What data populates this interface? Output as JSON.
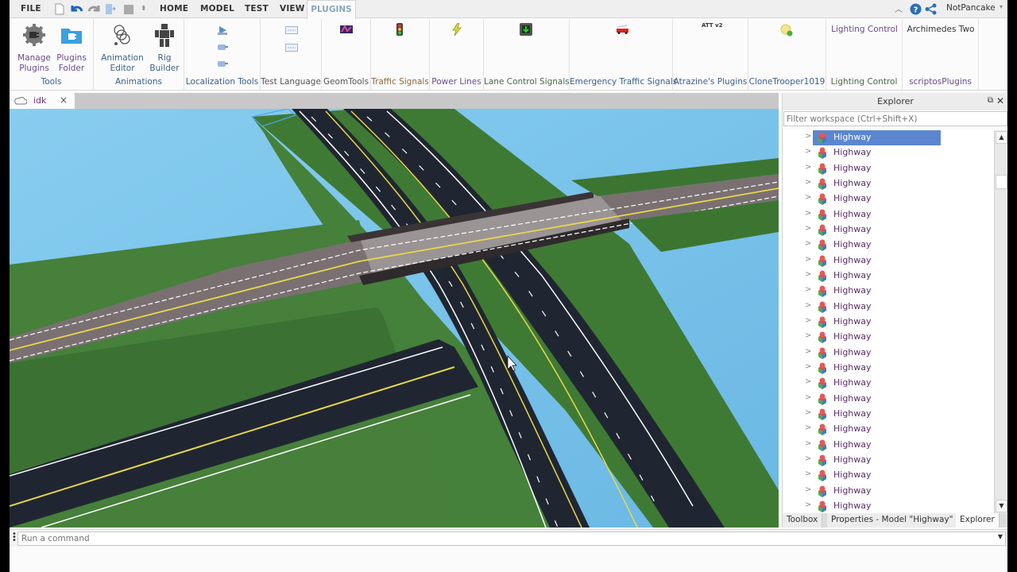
{
  "menubar": {
    "file": "FILE",
    "tabs": [
      "HOME",
      "MODEL",
      "TEST",
      "VIEW",
      "PLUGINS"
    ],
    "active_tab": "PLUGINS",
    "user": "NotPancake",
    "quick_access": [
      "new-file-icon",
      "undo-icon",
      "redo-icon",
      "publish-icon",
      "stop-icon",
      "customize-icon"
    ]
  },
  "ribbon": {
    "groups": [
      {
        "label": "Tools",
        "buttons": [
          {
            "label1": "Manage",
            "label2": "Plugins",
            "icon": "plugin-gear-icon"
          },
          {
            "label1": "Plugins",
            "label2": "Folder",
            "icon": "plugin-folder-icon"
          }
        ]
      },
      {
        "label": "Animations",
        "buttons": [
          {
            "label1": "Animation",
            "label2": "Editor",
            "icon": "animation-rings-icon"
          },
          {
            "label1": "Rig",
            "label2": "Builder",
            "icon": "rig-figure-icon"
          }
        ]
      },
      {
        "label": "Localization Tools"
      },
      {
        "label": "Test Language"
      },
      {
        "label": "GeomTools"
      },
      {
        "label": "Traffic Signals"
      },
      {
        "label": "Power Lines"
      },
      {
        "label": "Lane Control Signals"
      },
      {
        "label": "Emergency Traffic Signals"
      },
      {
        "label": "Atrazine's Plugins",
        "icon_text": "ATT v2"
      },
      {
        "label": "CloneTrooper1019"
      },
      {
        "label": "Lighting Control",
        "top_text": "Lighting Control"
      },
      {
        "label": "scriptosPlugins",
        "top_text": "Archimedes Two"
      }
    ]
  },
  "document": {
    "tab_name": "idk",
    "close": "×"
  },
  "explorer": {
    "title": "Explorer",
    "filter_placeholder": "Filter workspace (Ctrl+Shift+X)",
    "items": [
      "Highway",
      "Highway",
      "Highway",
      "Highway",
      "Highway",
      "Highway",
      "Highway",
      "Highway",
      "Highway",
      "Highway",
      "Highway",
      "Highway",
      "Highway",
      "Highway",
      "Highway",
      "Highway",
      "Highway",
      "Highway",
      "Highway",
      "Highway",
      "Highway",
      "Highway",
      "Highway",
      "Highway",
      "Highway"
    ],
    "selected_index": 0,
    "bottom_tabs": [
      "Toolbox",
      "Properties - Model \"Highway\"",
      "Explorer"
    ],
    "active_bottom_tab": "Explorer"
  },
  "command_bar": {
    "placeholder": "Run a command"
  },
  "colors": {
    "sky": "#7fc4ea",
    "grass": "#3f7a34",
    "asphalt": "#1f2631",
    "bridge": "#7a7071",
    "selection": "#5b86cf",
    "tab_accent": "#8ea3bb"
  }
}
